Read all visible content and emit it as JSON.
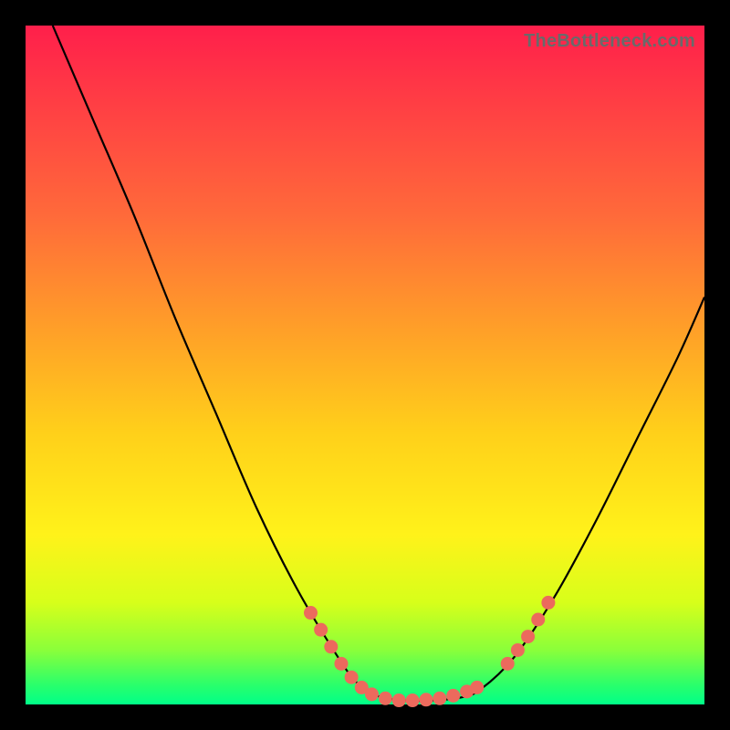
{
  "watermark": "TheBottleneck.com",
  "colors": {
    "frame": "#000000",
    "curve_stroke": "#000000",
    "marker_fill": "#ec6a5d",
    "marker_stroke": "#ec6a5d",
    "gradient_stops": [
      "#ff1f4b",
      "#ff3a45",
      "#ff6a3a",
      "#ffa028",
      "#ffd01a",
      "#fff21a",
      "#d7ff1a",
      "#8aff3a",
      "#2cff6a",
      "#00ff88"
    ]
  },
  "chart_data": {
    "type": "line",
    "title": "",
    "xlabel": "",
    "ylabel": "",
    "xlim": [
      0,
      100
    ],
    "ylim": [
      0,
      100
    ],
    "grid": false,
    "legend": null,
    "curves": [
      {
        "name": "left-branch",
        "x": [
          4,
          10,
          16,
          22,
          28,
          34,
          40,
          46,
          49
        ],
        "y": [
          100,
          86,
          72,
          57,
          43,
          29,
          17,
          7,
          3
        ]
      },
      {
        "name": "valley",
        "x": [
          49,
          52,
          56,
          60,
          64,
          67
        ],
        "y": [
          3,
          1.2,
          0.6,
          0.6,
          1.0,
          2.2
        ]
      },
      {
        "name": "right-branch",
        "x": [
          67,
          72,
          78,
          84,
          90,
          96,
          100
        ],
        "y": [
          2.2,
          7,
          16,
          27,
          39,
          51,
          60
        ]
      }
    ],
    "markers": {
      "name": "highlighted-points",
      "comment": "salmon dots clustered along lower valley and lower slopes",
      "points": [
        {
          "x": 42,
          "y": 13.5
        },
        {
          "x": 43.5,
          "y": 11
        },
        {
          "x": 45,
          "y": 8.5
        },
        {
          "x": 46.5,
          "y": 6
        },
        {
          "x": 48,
          "y": 4
        },
        {
          "x": 49.5,
          "y": 2.5
        },
        {
          "x": 51,
          "y": 1.5
        },
        {
          "x": 53,
          "y": 0.9
        },
        {
          "x": 55,
          "y": 0.6
        },
        {
          "x": 57,
          "y": 0.6
        },
        {
          "x": 59,
          "y": 0.7
        },
        {
          "x": 61,
          "y": 0.9
        },
        {
          "x": 63,
          "y": 1.3
        },
        {
          "x": 65,
          "y": 1.9
        },
        {
          "x": 66.5,
          "y": 2.5
        },
        {
          "x": 71,
          "y": 6
        },
        {
          "x": 72.5,
          "y": 8
        },
        {
          "x": 74,
          "y": 10
        },
        {
          "x": 75.5,
          "y": 12.5
        },
        {
          "x": 77,
          "y": 15
        }
      ]
    }
  }
}
